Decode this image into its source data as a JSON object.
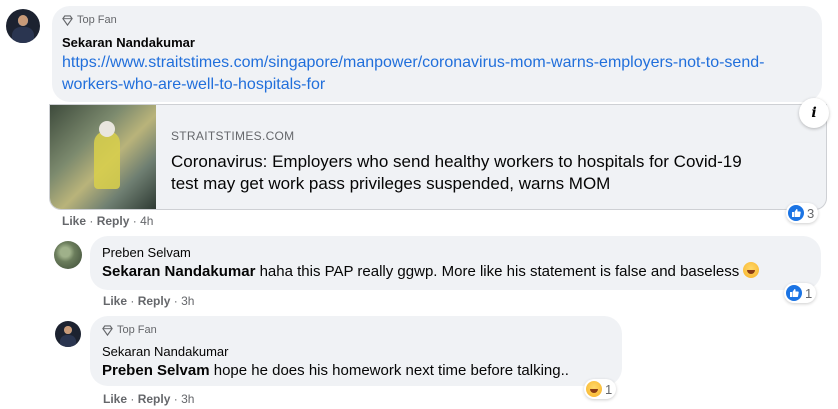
{
  "comment1": {
    "badge": "Top Fan",
    "author": "Sekaran Nandakumar",
    "link_line1": "https://www.straitstimes.com/singapore/manpower/coronavirus-mom-warns-employers-not-to-send-",
    "link_line2": "workers-who-are-well-to-hospitals-for",
    "preview": {
      "domain": "STRAITSTIMES.COM",
      "title_line1": "Coronavirus: Employers who send healthy workers to hospitals for Covid-19",
      "title_line2": "test may get work pass privileges suspended, warns MOM",
      "info_icon": "i"
    },
    "actions": {
      "like": "Like",
      "sep": "·",
      "reply": "Reply",
      "time": "4h"
    },
    "reaction": {
      "icon": "like-icon",
      "count": "3"
    }
  },
  "reply1": {
    "author": "Preben Selvam",
    "mention": "Sekaran Nandakumar",
    "text": " haha this PAP really ggwp. More like his statement is false and baseless ",
    "actions": {
      "like": "Like",
      "sep": "·",
      "reply": "Reply",
      "time": "3h"
    },
    "reaction": {
      "icon": "like-icon",
      "count": "1"
    }
  },
  "reply2": {
    "badge": "Top Fan",
    "author": "Sekaran Nandakumar",
    "mention": "Preben Selvam",
    "text": " hope he does his homework next time before talking..",
    "actions": {
      "like": "Like",
      "sep": "·",
      "reply": "Reply",
      "time": "3h"
    },
    "reaction": {
      "icon": "haha-icon",
      "count": "1"
    }
  },
  "colors": {
    "link": "#216fdb",
    "bubble": "#f0f2f5",
    "like_blue": "#1b74e4"
  }
}
